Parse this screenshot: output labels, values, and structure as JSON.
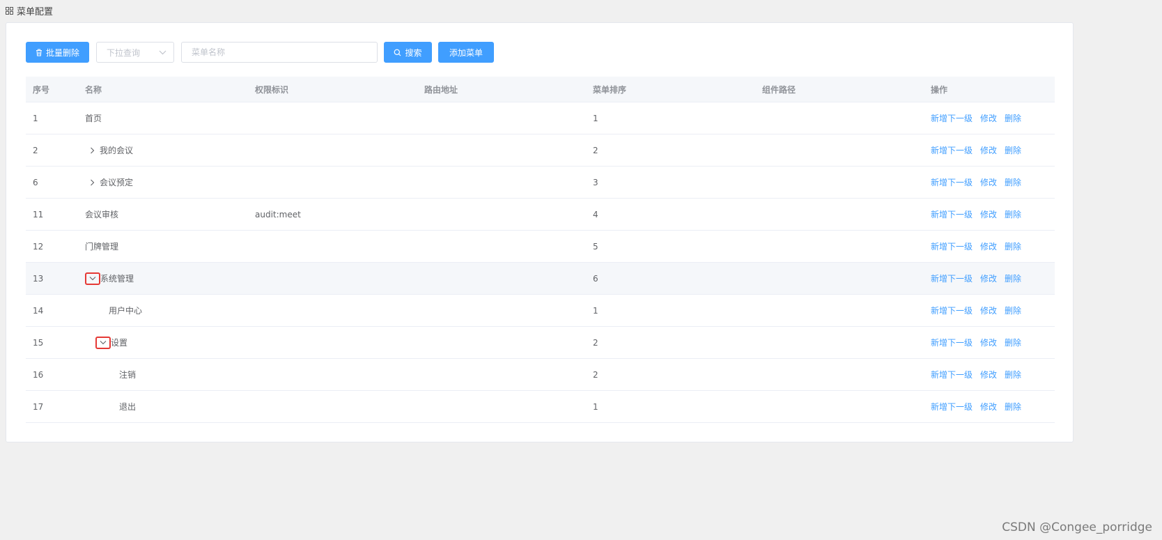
{
  "header": {
    "title": "菜单配置"
  },
  "toolbar": {
    "delete_label": "批量删除",
    "select_placeholder": "下拉查询",
    "search_placeholder": "菜单名称",
    "search_label": "搜索",
    "add_label": "添加菜单"
  },
  "table": {
    "columns": [
      "序号",
      "名称",
      "权限标识",
      "路由地址",
      "菜单排序",
      "组件路径",
      "操作"
    ],
    "actions": {
      "add_child": "新增下一级",
      "edit": "修改",
      "delete": "删除"
    },
    "rows": [
      {
        "id": "1",
        "name": "首页",
        "perm": "",
        "route": "",
        "order": "1",
        "path": ""
      },
      {
        "id": "2",
        "name": "我的会议",
        "perm": "",
        "route": "",
        "order": "2",
        "path": ""
      },
      {
        "id": "6",
        "name": "会议预定",
        "perm": "",
        "route": "",
        "order": "3",
        "path": ""
      },
      {
        "id": "11",
        "name": "会议审核",
        "perm": "audit:meet",
        "route": "",
        "order": "4",
        "path": ""
      },
      {
        "id": "12",
        "name": "门牌管理",
        "perm": "",
        "route": "",
        "order": "5",
        "path": ""
      },
      {
        "id": "13",
        "name": "系统管理",
        "perm": "",
        "route": "",
        "order": "6",
        "path": ""
      },
      {
        "id": "14",
        "name": "用户中心",
        "perm": "",
        "route": "",
        "order": "1",
        "path": ""
      },
      {
        "id": "15",
        "name": "设置",
        "perm": "",
        "route": "",
        "order": "2",
        "path": ""
      },
      {
        "id": "16",
        "name": "注销",
        "perm": "",
        "route": "",
        "order": "2",
        "path": ""
      },
      {
        "id": "17",
        "name": "退出",
        "perm": "",
        "route": "",
        "order": "1",
        "path": ""
      }
    ]
  },
  "watermark": "CSDN @Congee_porridge",
  "colors": {
    "primary": "#409eff",
    "highlight_box": "#e53935"
  }
}
